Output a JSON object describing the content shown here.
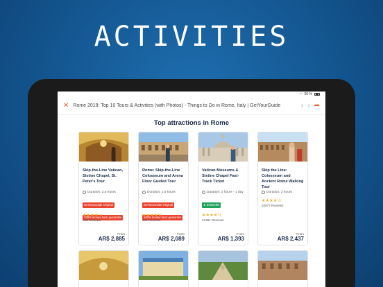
{
  "headline": "ACTIVITIES",
  "status": {
    "wifi": "wifi",
    "battery_pct": "55 %"
  },
  "toolbar": {
    "close_icon": "close-icon",
    "title": "Rome 2019: Top 10 Tours & Activities (with Photos) - Things to Do in Rome, Italy | GetYourGuide",
    "back": "‹",
    "forward": "›",
    "share_icon": "share-icon"
  },
  "section_title": "Top attractions in Rome",
  "colors": {
    "accent": "#f25a2b",
    "tag_red": "#e8442f",
    "tag_green": "#1fa35c",
    "star": "#f7a81b"
  },
  "cards": [
    {
      "title": "Skip-the-Line Vatican, Sistine Chapel, St. Peter's Tour",
      "duration": "Duration: 2.5 hours",
      "tags": [
        {
          "text": "GetYourGuide Original",
          "color": "red"
        },
        {
          "text": "100% money back guarantee",
          "color": "red"
        }
      ],
      "stars": "★★★★½",
      "reviews": "648 Reviews",
      "from": "From",
      "price": "AR$ 2,885"
    },
    {
      "title": "Rome: Skip-the-Line Colosseum and Arena Floor Guided Tour",
      "duration": "Duration: 1.5 hours",
      "tags": [
        {
          "text": "GetYourGuide Original",
          "color": "red"
        },
        {
          "text": "100% money back guarantee",
          "color": "red"
        }
      ],
      "stars": "★★★★½",
      "reviews": "181 Reviews",
      "from": "From",
      "price": "AR$ 2,089"
    },
    {
      "title": "Vatican Museums & Sistine Chapel Fast-Track Ticket",
      "duration": "Duration: 2 hours - 1 day",
      "tags": [
        {
          "text": "Bestseller",
          "color": "green"
        }
      ],
      "stars": "★★★★½",
      "reviews": "21491 Reviews",
      "from": "From",
      "price": "AR$ 1,393"
    },
    {
      "title": "Skip the Line: Colosseum and Ancient Rome Walking Tour",
      "duration": "Duration: 3 hours",
      "tags": [],
      "stars": "★★★★½",
      "reviews": "10877 Reviews",
      "from": "From",
      "price": "AR$ 2,437"
    }
  ]
}
